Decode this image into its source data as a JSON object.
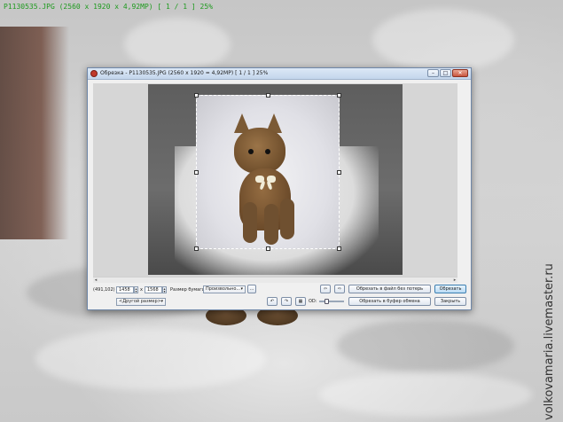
{
  "background": {
    "caption": "P1130535.JPG  (2560 x 1920 x 4,92MP)  [ 1 / 1 ]  25%",
    "watermark": "volkovamaria.livemaster.ru"
  },
  "window": {
    "title": "Обрезка  -  P1130535.JPG  (2560 x 1920 = 4,92MP)  [ 1 / 1 ]  25%",
    "minimize_glyph": "–",
    "maximize_glyph": "□",
    "close_glyph": "✕",
    "app_icon": "irfanview-cat-icon"
  },
  "image": {
    "description_icon": "photo-canvas",
    "crop_selection": "dashed-rectangle"
  },
  "controls": {
    "cursor_pos": "(491,102)",
    "width_value": "1458",
    "times_label": "x",
    "height_value": "1568",
    "ratio_label": "Размер бумаги:",
    "ratio_value": "Произвольно...",
    "ratio_more": "...",
    "size_preset": "<Другой размер>",
    "zoom_label": "OD:",
    "save_lossless": "Обрезать в файл без потерь",
    "crop_button": "Обрезать",
    "copy_clipboard": "Обрезать в буфер обмена",
    "close_button": "Закрыть",
    "rotate_left": "↶",
    "rotate_right": "↷",
    "grid_toggle": "▦",
    "prev_button": "⇦",
    "next_button": "⇨"
  },
  "colors": {
    "primary_button": "#b8daf4",
    "caption_green": "#1f9a1f"
  }
}
